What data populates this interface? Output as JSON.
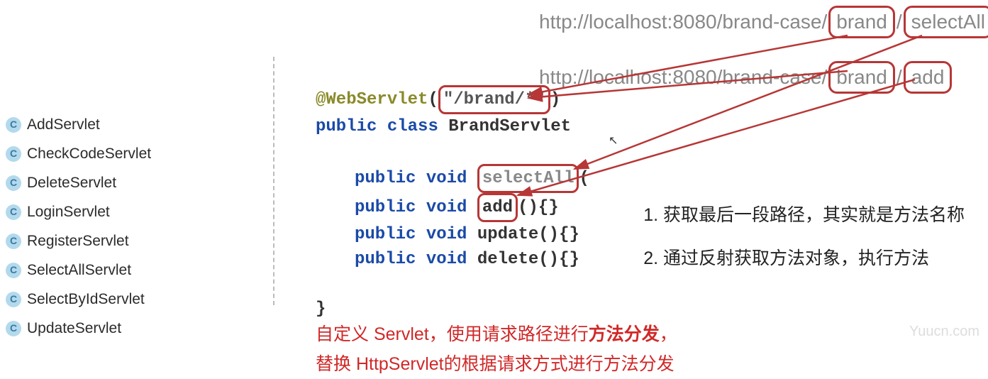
{
  "sidebar": {
    "items": [
      {
        "label": "AddServlet"
      },
      {
        "label": "CheckCodeServlet"
      },
      {
        "label": "DeleteServlet"
      },
      {
        "label": "LoginServlet"
      },
      {
        "label": "RegisterServlet"
      },
      {
        "label": "SelectAllServlet"
      },
      {
        "label": "SelectByIdServlet"
      },
      {
        "label": "UpdateServlet"
      }
    ],
    "icon_letter": "C"
  },
  "urls": {
    "prefix": "http://localhost:8080/brand-case/",
    "path1_seg1": "brand",
    "path1_seg2": "selectAll",
    "path2_seg1": "brand",
    "path2_seg2": "add"
  },
  "code": {
    "annotation_name": "@WebServlet",
    "annotation_open": "(",
    "annotation_value": "\"/brand/*\"",
    "annotation_close": ")",
    "kw_public": "public",
    "kw_class": "class",
    "class_name": "BrandServlet",
    "kw_void": "void",
    "method1": "selectAll",
    "method1_tail": "(",
    "method2": "add",
    "method2_tail": "(){}",
    "method3": "update(){}",
    "method4": "delete(){}",
    "brace": "}"
  },
  "steps": {
    "item1": "获取最后一段路径，其实就是方法名称",
    "item2": "通过反射获取方法对象，执行方法"
  },
  "bottom": {
    "line1a": "自定义 Servlet，使用请求路径进行",
    "line1b": "方法分发",
    "line1c": "，",
    "line2": "替换 HttpServlet的根据请求方式进行方法分发"
  },
  "watermark": "Yuucn.com"
}
